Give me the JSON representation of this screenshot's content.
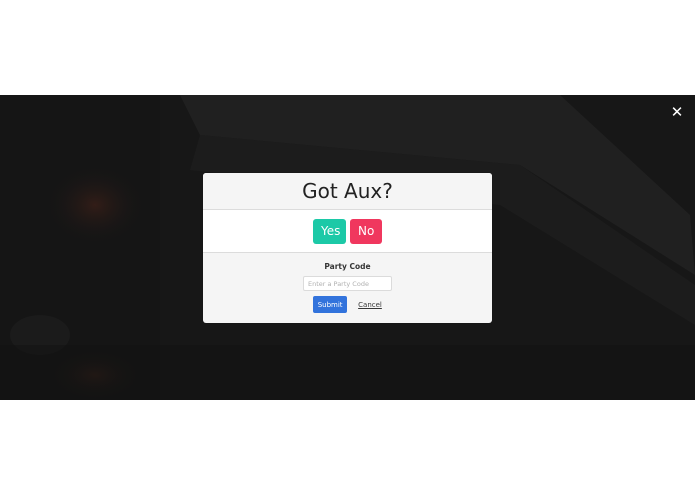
{
  "modal": {
    "title": "Got Aux?",
    "yes_label": "Yes",
    "no_label": "No",
    "party_code_label": "Party Code",
    "party_code_placeholder": "Enter a Party Code",
    "party_code_value": "",
    "submit_label": "Submit",
    "cancel_label": "Cancel"
  },
  "overlay": {
    "close_icon": "close-icon"
  },
  "colors": {
    "yes": "#1cc9a7",
    "no": "#f0375e",
    "submit": "#3273dc",
    "backdrop": "#161616"
  }
}
